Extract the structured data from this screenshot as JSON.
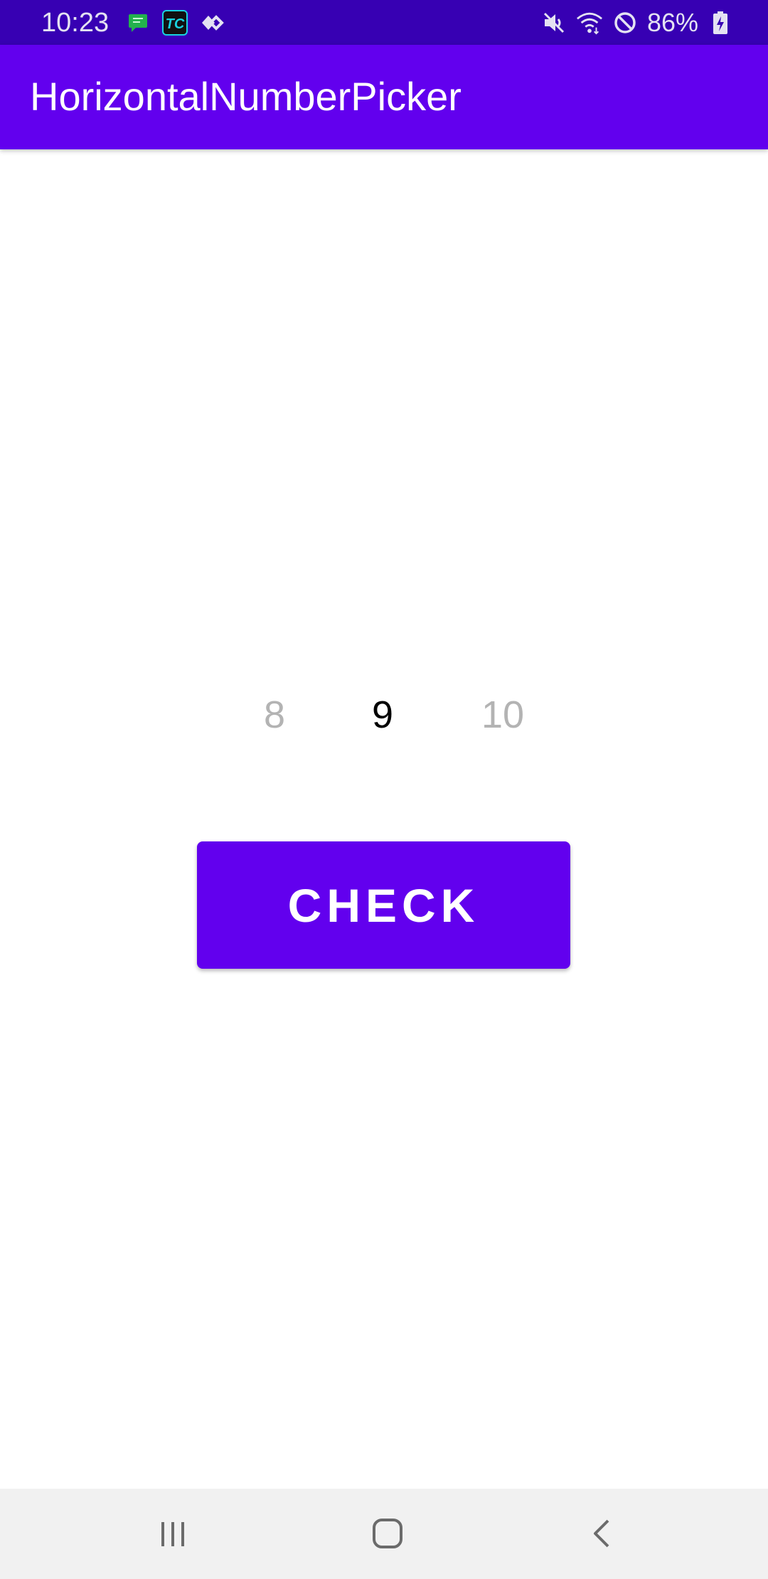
{
  "status_bar": {
    "time": "10:23",
    "battery_percent": "86%",
    "background": "#3700b3",
    "notification_icons": [
      "chat-bubble-icon",
      "tc-app-icon",
      "diamond-arrows-icon"
    ],
    "system_icons": [
      "mute-icon",
      "wifi-icon",
      "do-not-disturb-icon",
      "battery-charging-icon"
    ]
  },
  "app_bar": {
    "title": "HorizontalNumberPicker",
    "background": "#6200ee"
  },
  "number_picker": {
    "previous": "8",
    "selected": "9",
    "next": "10",
    "dim_color": "#b3b3b3",
    "selected_color": "#000000"
  },
  "check_button": {
    "label": "CHECK",
    "background": "#6200ee"
  },
  "nav_bar": {
    "buttons": [
      "recent-apps-icon",
      "home-icon",
      "back-icon"
    ]
  }
}
